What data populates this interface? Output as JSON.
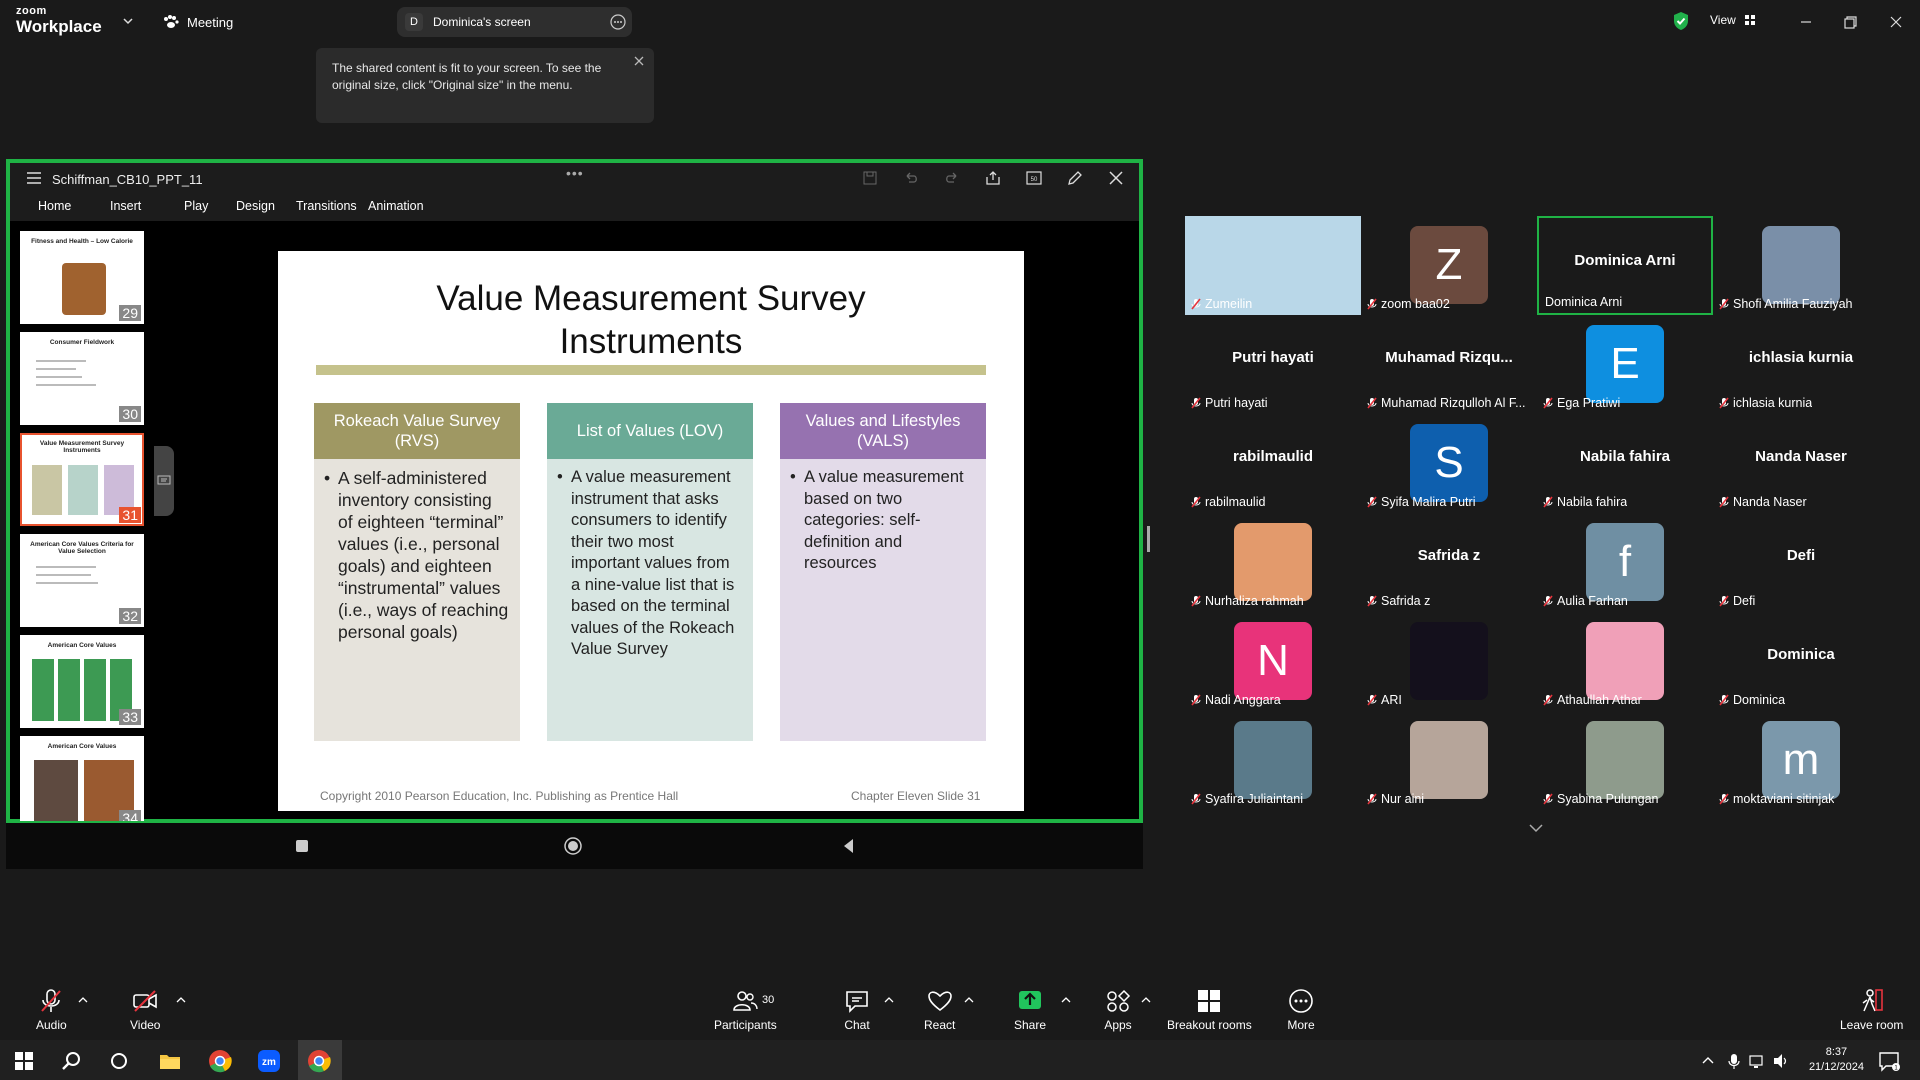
{
  "app": {
    "brand_top": "zoom",
    "brand_bottom": "Workplace",
    "meeting_label": "Meeting",
    "screen_pill_initial": "D",
    "screen_pill_label": "Dominica's screen",
    "view_label": "View"
  },
  "tooltip": {
    "text": "The shared content is fit to your screen. To see the original size, click \"Original size\" in the menu."
  },
  "ppt": {
    "title": "Schiffman_CB10_PPT_11",
    "tabs": [
      "Home",
      "Insert",
      "Play",
      "Design",
      "Transitions",
      "Animation"
    ],
    "thumbnails": [
      {
        "title": "Fitness and Health – Low Calorie",
        "number": "29"
      },
      {
        "title": "Consumer Fieldwork",
        "number": "30"
      },
      {
        "title": "Value Measurement Survey Instruments",
        "number": "31"
      },
      {
        "title": "American Core Values Criteria for Value Selection",
        "number": "32"
      },
      {
        "title": "American Core Values",
        "number": "33"
      },
      {
        "title": "American Core Values",
        "number": "34"
      }
    ]
  },
  "slide": {
    "title": "Value Measurement Survey Instruments",
    "columns": [
      {
        "heading": "Rokeach Value Survey (RVS)",
        "body": "A self-administered inventory consisting of eighteen “terminal” values (i.e., personal goals) and eighteen “instrumental” values (i.e., ways of reaching personal goals)",
        "head_color": "#9f9863",
        "body_color": "#e6e3dc"
      },
      {
        "heading": "List of Values (LOV)",
        "body": "A value measurement instrument that asks consumers to identify their two most important values from a nine-value list that is based on the terminal values of the Rokeach Value Survey",
        "head_color": "#6aaa96",
        "body_color": "#d8e6e2"
      },
      {
        "heading": "Values and Lifestyles (VALS)",
        "body": "A value measurement based on two categories: self-definition and resources",
        "head_color": "#9672b0",
        "body_color": "#e3dbe9"
      }
    ],
    "footer_left": "Copyright 2010 Pearson Education, Inc. Publishing as Prentice Hall",
    "footer_right": "Chapter Eleven  Slide 31"
  },
  "participants": [
    {
      "name": "Zumeilin",
      "display": "image",
      "color": "#b9d7e8"
    },
    {
      "name": "zoom baa02",
      "display": "Z",
      "color": "#6b4a3e"
    },
    {
      "name": "Dominica Arni",
      "display": "Dominica Arni",
      "color": ""
    },
    {
      "name": "Shofi Amilia Fauziyah",
      "display": "image",
      "color": "#7a8fa8"
    },
    {
      "name": "Putri hayati",
      "display": "Putri hayati",
      "color": ""
    },
    {
      "name": "Muhamad Rizqulloh Al F...",
      "display": "Muhamad  Rizqu...",
      "color": ""
    },
    {
      "name": "Ega Pratiwi",
      "display": "E",
      "color": "#0e8fe0"
    },
    {
      "name": "ichlasia kurnia",
      "display": "ichlasia kurnia",
      "color": ""
    },
    {
      "name": "rabilmaulid",
      "display": "rabilmaulid",
      "color": ""
    },
    {
      "name": "Syifa Malira Putri",
      "display": "S",
      "color": "#0e5fae"
    },
    {
      "name": "Nabila fahira",
      "display": "Nabila fahira",
      "color": ""
    },
    {
      "name": "Nanda Naser",
      "display": "Nanda Naser",
      "color": ""
    },
    {
      "name": "Nurhaliza rahmah",
      "display": "image",
      "color": "#e39a6c"
    },
    {
      "name": "Safrida z",
      "display": "Safrida z",
      "color": ""
    },
    {
      "name": "Aulia Farhan",
      "display": "f",
      "color": "#6f8fa3"
    },
    {
      "name": "Defi",
      "display": "Defi",
      "color": ""
    },
    {
      "name": "Nadi Anggara",
      "display": "N",
      "color": "#e8337a"
    },
    {
      "name": "ARI",
      "display": "image",
      "color": "#14101c"
    },
    {
      "name": "Athaullah Athar",
      "display": "image",
      "color": "#f0a0b8"
    },
    {
      "name": "Dominica",
      "display": "Dominica",
      "color": ""
    },
    {
      "name": "Syafira Juliaintani",
      "display": "image",
      "color": "#5a7a8a"
    },
    {
      "name": "Nur aini",
      "display": "image",
      "color": "#b6a59a"
    },
    {
      "name": "Syabina Pulungan",
      "display": "image",
      "color": "#8e9b8c"
    },
    {
      "name": "moktaviani sitinjak",
      "display": "m",
      "color": "#7b98ab"
    }
  ],
  "toolbar": {
    "audio": "Audio",
    "video": "Video",
    "participants": "Participants",
    "participant_count": "30",
    "chat": "Chat",
    "react": "React",
    "share": "Share",
    "apps": "Apps",
    "breakout": "Breakout rooms",
    "more": "More",
    "leave": "Leave room"
  },
  "taskbar": {
    "time": "8:37",
    "date": "21/12/2024"
  }
}
